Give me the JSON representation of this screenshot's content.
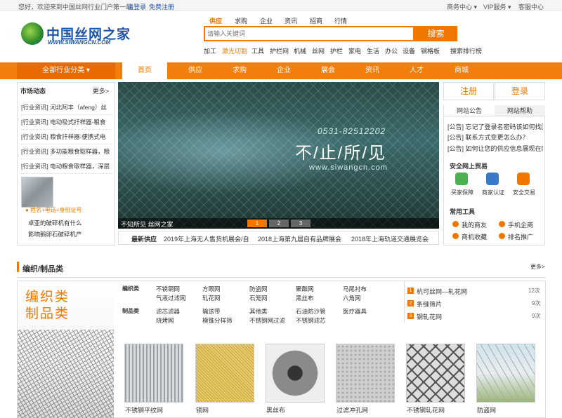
{
  "topbar": {
    "welcome": "您好，欢迎来到中国丝网行业门户第一站",
    "login": "请登录",
    "register": "免费注册",
    "business_center": "商务中心",
    "vip_service": "VIP服务",
    "customer_service": "客服中心"
  },
  "header": {
    "logo_cn": "中国丝网之家",
    "logo_en": "WWW.SIWANGCN.COM",
    "search_tabs": [
      "供应",
      "求购",
      "企业",
      "资讯",
      "招商",
      "行情"
    ],
    "search_placeholder": "请输入关键词",
    "search_button": "搜索",
    "hot_keywords": [
      "加工",
      "激光切割",
      "工具",
      "护栏网",
      "机械",
      "丝网",
      "护栏",
      "家电",
      "生活",
      "办公",
      "设备",
      "钢格板"
    ],
    "search_rank": "搜索排行榜"
  },
  "nav": {
    "all_categories": "全部行业分类",
    "items": [
      "首页",
      "供应",
      "求购",
      "企业",
      "展会",
      "资讯",
      "人才",
      "商城"
    ]
  },
  "market": {
    "title": "市场动态",
    "more": "更多>",
    "news": [
      "[行业资讯] 河北阿丰（afeng）丝",
      "[行业资讯] 电动吸式扦样器-粮食",
      "[行业资讯] 粮食扦样器-便携式电",
      "[行业资讯] 多功能粮食取样器，粮",
      "[行业资讯] 电动粮食取样器，深层"
    ],
    "ad_text": "姓名+电话+身份证号",
    "links": [
      "卓亚的破碎机有什么",
      "影响鹅卵石破碎机产"
    ]
  },
  "banner": {
    "phone": "0531-82512202",
    "slogan": "不/止/所/见",
    "url": "www.siwangcn.com",
    "caption": "不知所见 丝网之家",
    "dots": [
      "1",
      "2",
      "3"
    ]
  },
  "latest": {
    "label": "最新供应",
    "items": [
      "2019年上海无人售货机展会/自",
      "2018上海第九届自有品牌展会",
      "2018年上海轨道交通展览会"
    ]
  },
  "user": {
    "register": "注册",
    "login": "登录"
  },
  "notice": {
    "tabs": [
      "网站公告",
      "网站帮助"
    ],
    "items": [
      "[公告] 忘记了登录名密码该如何找回",
      "[公告] 联系方式变更怎么办？",
      "[公告] 如何让您的供应信息展现在网"
    ]
  },
  "security": {
    "title": "安全网上贸易",
    "items": [
      "买家保障",
      "商家认证",
      "安全交易"
    ],
    "colors": [
      "#4caf50",
      "#3a78c8",
      "#f07800"
    ]
  },
  "tools": {
    "title": "常用工具",
    "items": [
      "我的商友",
      "手机企商",
      "商机收藏",
      "排名推广"
    ]
  },
  "section": {
    "title": "编织/制品类",
    "more": "更多>",
    "big1": "编织类",
    "big2": "制品类",
    "cat1_label": "编织类",
    "cat1_items": [
      "不锈钢网",
      "方眼网",
      "防盗网",
      "聚酯网",
      "马尾衬布",
      "气液过滤网",
      "轧花网",
      "石笼网",
      "黑丝布",
      "六角网"
    ],
    "cat2_label": "制品类",
    "cat2_items": [
      "滤芯滤器",
      "输送带",
      "其他类",
      "石油防沙管",
      "医疗器具",
      "烧烤网",
      "模锥分样筛",
      "不锈钢网过滤",
      "不锈钢滤芯"
    ],
    "rank": [
      {
        "num": "1",
        "name": "杭可丝网—轧花网",
        "count": "12次"
      },
      {
        "num": "2",
        "name": "条缝筛片",
        "count": "9次"
      },
      {
        "num": "3",
        "name": "钢轧花网",
        "count": "9次"
      }
    ],
    "products": [
      "不锈钢平纹网",
      "铜网",
      "黑丝布",
      "过滤冲孔网",
      "不锈钢轧花网",
      "防盗网"
    ]
  }
}
